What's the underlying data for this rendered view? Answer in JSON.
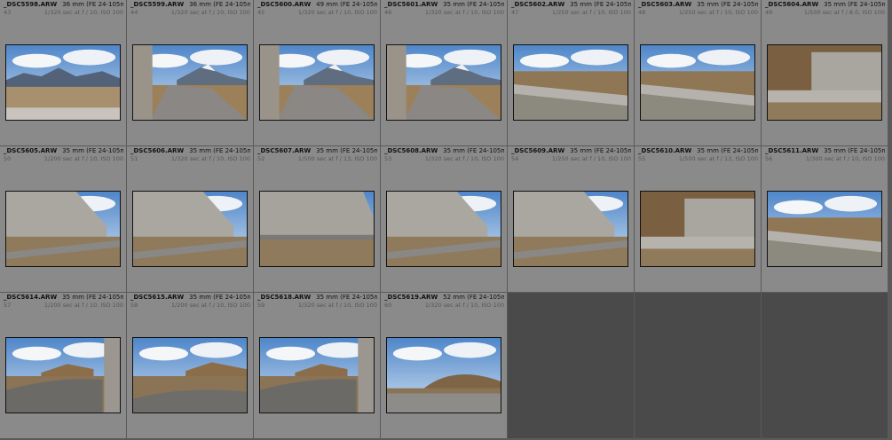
{
  "cells": [
    {
      "name": "_DSC5598.ARW",
      "lens": "36 mm (FE 24-105mm F4...",
      "index": "43",
      "exposure": "1/320 sec at f / 10, ISO 100",
      "scene": "mountain-wide"
    },
    {
      "name": "_DSC5599.ARW",
      "lens": "36 mm (FE 24-105mm F4...",
      "index": "44",
      "exposure": "1/320 sec at f / 10, ISO 100",
      "scene": "mountain-road-wall"
    },
    {
      "name": "_DSC5600.ARW",
      "lens": "49 mm (FE 24-105mm F4...",
      "index": "45",
      "exposure": "1/320 sec at f / 10, ISO 100",
      "scene": "mountain-road-wall"
    },
    {
      "name": "_DSC5601.ARW",
      "lens": "35 mm (FE 24-105mm F4 G...",
      "index": "46",
      "exposure": "1/320 sec at f / 10, ISO 100",
      "scene": "mountain-road-wall"
    },
    {
      "name": "_DSC5602.ARW",
      "lens": "35 mm (FE 24-105mm F4 G...",
      "index": "47",
      "exposure": "1/250 sec at f / 10, ISO 100",
      "scene": "road-barrier"
    },
    {
      "name": "_DSC5603.ARW",
      "lens": "35 mm (FE 24-105mm F4 G...",
      "index": "48",
      "exposure": "1/250 sec at f / 10, ISO 100",
      "scene": "road-barrier"
    },
    {
      "name": "_DSC5604.ARW",
      "lens": "35 mm (FE 24-105mm F4 G...",
      "index": "49",
      "exposure": "1/500 sec at f / 8.0, ISO 100",
      "scene": "wall-front"
    },
    {
      "name": "_DSC5605.ARW",
      "lens": "35 mm (FE 24-105mm F4 G...",
      "index": "50",
      "exposure": "1/200 sec at f / 10, ISO 100",
      "scene": "wall-left"
    },
    {
      "name": "_DSC5606.ARW",
      "lens": "35 mm (FE 24-105mm F4 G...",
      "index": "51",
      "exposure": "1/320 sec at f / 10, ISO 100",
      "scene": "wall-left"
    },
    {
      "name": "_DSC5607.ARW",
      "lens": "35 mm (FE 24-105mm F4 G...",
      "index": "52",
      "exposure": "1/500 sec at f / 13, ISO 100",
      "scene": "wall-close"
    },
    {
      "name": "_DSC5608.ARW",
      "lens": "35 mm (FE 24-105mm F4 G...",
      "index": "53",
      "exposure": "1/320 sec at f / 10, ISO 100",
      "scene": "wall-left"
    },
    {
      "name": "_DSC5609.ARW",
      "lens": "35 mm (FE 24-105mm F4 G...",
      "index": "54",
      "exposure": "1/250 sec at f / 10, ISO 100",
      "scene": "wall-left"
    },
    {
      "name": "_DSC5610.ARW",
      "lens": "35 mm (FE 24-105mm F4 G...",
      "index": "55",
      "exposure": "1/500 sec at f / 13, ISO 100",
      "scene": "wall-front"
    },
    {
      "name": "_DSC5611.ARW",
      "lens": "35 mm (FE 24-105mm F4 G...",
      "index": "56",
      "exposure": "1/300 sec at f / 10, ISO 100",
      "scene": "road-barrier"
    },
    {
      "name": "_DSC5614.ARW",
      "lens": "35 mm (FE 24-105mm F4 G...",
      "index": "57",
      "exposure": "1/200 sec at f / 10, ISO 100",
      "scene": "curve-wall-right"
    },
    {
      "name": "_DSC5615.ARW",
      "lens": "35 mm (FE 24-105mm F4 G...",
      "index": "58",
      "exposure": "1/200 sec at f / 10, ISO 100",
      "scene": "curve"
    },
    {
      "name": "_DSC5618.ARW",
      "lens": "35 mm (FE 24-105mm F4 G...",
      "index": "59",
      "exposure": "1/320 sec at f / 10, ISO 100",
      "scene": "curve-wall-right"
    },
    {
      "name": "_DSC5619.ARW",
      "lens": "52 mm (FE 24-105mm F4 G...",
      "index": "60",
      "exposure": "1/320 sec at f / 10, ISO 100",
      "scene": "hill"
    }
  ]
}
